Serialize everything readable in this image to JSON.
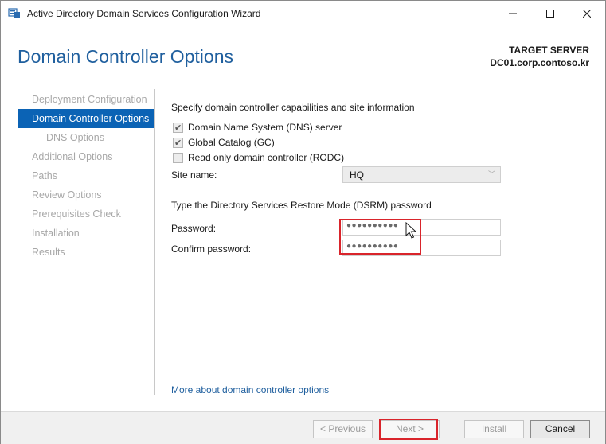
{
  "window": {
    "title": "Active Directory Domain Services Configuration Wizard"
  },
  "header": {
    "page_title": "Domain Controller Options",
    "target_label": "TARGET SERVER",
    "target_name": "DC01.corp.contoso.kr"
  },
  "nav": {
    "items": [
      {
        "label": "Deployment Configuration",
        "state": "disabled"
      },
      {
        "label": "Domain Controller Options",
        "state": "active"
      },
      {
        "label": "DNS Options",
        "state": "disabled"
      },
      {
        "label": "Additional Options",
        "state": "disabled"
      },
      {
        "label": "Paths",
        "state": "disabled"
      },
      {
        "label": "Review Options",
        "state": "disabled"
      },
      {
        "label": "Prerequisites Check",
        "state": "disabled"
      },
      {
        "label": "Installation",
        "state": "disabled"
      },
      {
        "label": "Results",
        "state": "disabled"
      }
    ]
  },
  "main": {
    "capabilities_title": "Specify domain controller capabilities and site information",
    "options": [
      {
        "label": "Domain Name System (DNS) server",
        "checked": true
      },
      {
        "label": "Global Catalog (GC)",
        "checked": true
      },
      {
        "label": "Read only domain controller (RODC)",
        "checked": false
      }
    ],
    "site_name_label": "Site name:",
    "site_name_value": "HQ",
    "dsrm_title": "Type the Directory Services Restore Mode (DSRM) password",
    "password_label": "Password:",
    "password_value": "●●●●●●●●●●",
    "confirm_label": "Confirm password:",
    "confirm_value": "●●●●●●●●●●",
    "more_link": "More about domain controller options"
  },
  "footer": {
    "previous": "< Previous",
    "next": "Next >",
    "install": "Install",
    "cancel": "Cancel"
  },
  "colors": {
    "accent": "#0b63b5",
    "title_blue": "#1f5f9e",
    "highlight_red": "#d9242b"
  }
}
